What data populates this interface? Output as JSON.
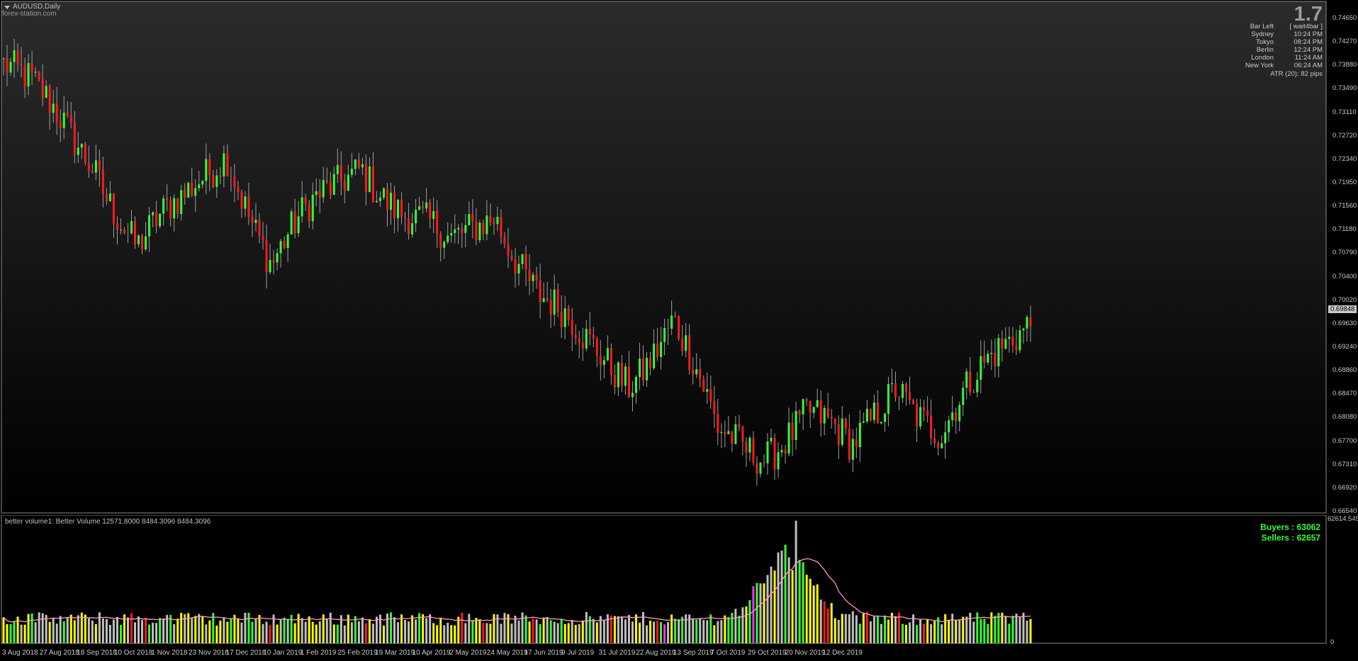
{
  "chart": {
    "symbol_title": "AUDUSD,Daily",
    "site": "forex-station.com",
    "spread_value": "1.7",
    "info_panel": [
      {
        "key": "Bar Left",
        "value": "[ wait4bar ]"
      },
      {
        "key": "Sydney",
        "value": "10:24 PM"
      },
      {
        "key": "Tokyo",
        "value": "08:24 PM"
      },
      {
        "key": "Berlin",
        "value": "12:24 PM"
      },
      {
        "key": "London",
        "value": "11:24 AM"
      },
      {
        "key": "New York",
        "value": "06:24 AM"
      }
    ],
    "atr_text": "ATR (20): 82 pips",
    "current_price": "0.69848",
    "price_axis": [
      "0.74650",
      "0.74270",
      "0.73880",
      "0.73490",
      "0.73110",
      "0.72720",
      "0.72340",
      "0.71950",
      "0.71560",
      "0.71180",
      "0.70790",
      "0.70400",
      "0.70020",
      "0.69630",
      "0.69240",
      "0.68860",
      "0.68470",
      "0.68080",
      "0.67700",
      "0.67310",
      "0.66920",
      "0.66540"
    ],
    "colors": {
      "background_top": "#2b2b2b",
      "background_bottom": "#000000",
      "bull": "#33ff33",
      "bear": "#ff1a1a",
      "wick": "#9e9e9e",
      "volume_ma": "#ff99cc"
    }
  },
  "volume": {
    "indicator_label": "better volume1:  Better Volume 12571.8000 8484.3096 8484.3096",
    "buyers_text": "Buyers : 63062",
    "sellers_text": "Sellers : 62657",
    "max_label": "62614.545",
    "zero_label": "0",
    "bar_colors": {
      "neutral": "#c0c0c0",
      "low": "#ffff00",
      "buy": "#33ff33",
      "sell": "#ff1a1a",
      "churn": "#ff33ff",
      "ma": "#ff99cc"
    }
  },
  "time_axis": [
    "3 Aug 2018",
    "27 Aug 2018",
    "18 Sep 2018",
    "10 Oct 2018",
    "1 Nov 2018",
    "23 Nov 2018",
    "17 Dec 2018",
    "10 Jan 2019",
    "1 Feb 2019",
    "25 Feb 2019",
    "19 Mar 2019",
    "10 Apr 2019",
    "2 May 2019",
    "24 May 2019",
    "17 Jun 2019",
    "9 Jul 2019",
    "31 Jul 2019",
    "22 Aug 2019",
    "13 Sep 2019",
    "7 Oct 2019",
    "29 Oct 2019",
    "20 Nov 2019",
    "12 Dec 2019"
  ],
  "chart_data": {
    "type": "candlestick",
    "title": "AUDUSD,Daily",
    "ylim": [
      0.6654,
      0.7465
    ],
    "anchors": [
      {
        "date": "3 Aug 2018",
        "close": 0.739
      },
      {
        "date": "27 Aug 2018",
        "close": 0.731
      },
      {
        "date": "18 Sep 2018",
        "close": 0.724
      },
      {
        "date": "10 Oct 2018",
        "close": 0.709
      },
      {
        "date": "1 Nov 2018",
        "close": 0.715
      },
      {
        "date": "23 Nov 2018",
        "close": 0.726
      },
      {
        "date": "17 Dec 2018",
        "close": 0.706
      },
      {
        "date": "10 Jan 2019",
        "close": 0.715
      },
      {
        "date": "1 Feb 2019",
        "close": 0.724
      },
      {
        "date": "25 Feb 2019",
        "close": 0.714
      },
      {
        "date": "19 Mar 2019",
        "close": 0.708
      },
      {
        "date": "10 Apr 2019",
        "close": 0.716
      },
      {
        "date": "2 May 2019",
        "close": 0.701
      },
      {
        "date": "24 May 2019",
        "close": 0.692
      },
      {
        "date": "17 Jun 2019",
        "close": 0.688
      },
      {
        "date": "9 Jul 2019",
        "close": 0.697
      },
      {
        "date": "31 Jul 2019",
        "close": 0.677
      },
      {
        "date": "22 Aug 2019",
        "close": 0.676
      },
      {
        "date": "13 Sep 2019",
        "close": 0.682
      },
      {
        "date": "7 Oct 2019",
        "close": 0.674
      },
      {
        "date": "29 Oct 2019",
        "close": 0.688
      },
      {
        "date": "20 Nov 2019",
        "close": 0.678
      },
      {
        "date": "12 Dec 2019",
        "close": 0.688
      },
      {
        "date": "24 Dec 2019",
        "close": 0.69848
      }
    ],
    "volume_ylim": [
      0,
      62614.545
    ]
  }
}
